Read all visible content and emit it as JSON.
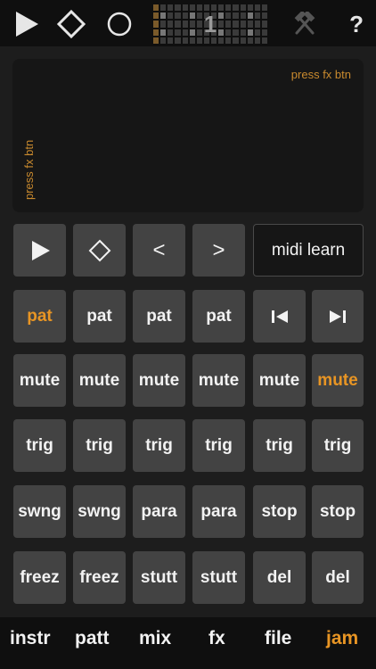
{
  "toolbar": {
    "play_icon": "play-icon",
    "stop_icon": "diamond-icon",
    "record_icon": "circle-icon",
    "pattern_number": "1",
    "tools_icon": "hammers-icon",
    "help_label": "?"
  },
  "xypad": {
    "horizontal_label": "press fx btn",
    "vertical_label": "press fx btn"
  },
  "transport": {
    "prev_label": "<",
    "next_label": ">",
    "midi_learn_label": "midi learn"
  },
  "rows": {
    "pat": [
      "pat",
      "pat",
      "pat",
      "pat"
    ],
    "mute": [
      "mute",
      "mute",
      "mute",
      "mute",
      "mute",
      "mute"
    ],
    "trig": [
      "trig",
      "trig",
      "trig",
      "trig",
      "trig",
      "trig"
    ],
    "swing": [
      "swng",
      "swng",
      "para",
      "para",
      "stop",
      "stop"
    ],
    "freeze": [
      "freez",
      "freez",
      "stutt",
      "stutt",
      "del",
      "del"
    ]
  },
  "tabs": [
    "instr",
    "patt",
    "mix",
    "fx",
    "file",
    "jam"
  ],
  "colors": {
    "accent": "#e89524",
    "button": "#434343",
    "background": "#1d1d1d"
  }
}
